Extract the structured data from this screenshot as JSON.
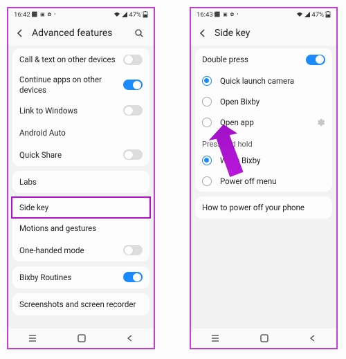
{
  "status": {
    "time1": "16:42",
    "time2": "16:43",
    "icons": "⬛ ▣ ✿ •",
    "battery": "47%"
  },
  "screen1": {
    "title": "Advanced features",
    "items": {
      "call_text": "Call & text on other devices",
      "continue_apps": "Continue apps on other devices",
      "link_windows": "Link to Windows",
      "android_auto": "Android Auto",
      "quick_share": "Quick Share",
      "labs": "Labs",
      "side_key": "Side key",
      "motions": "Motions and gestures",
      "one_handed": "One-handed mode",
      "bixby_routines": "Bixby Routines",
      "screenshots": "Screenshots and screen recorder"
    }
  },
  "screen2": {
    "title": "Side key",
    "double_press": "Double press",
    "opts1": {
      "camera": "Quick launch camera",
      "bixby": "Open Bixby",
      "app": "Open app"
    },
    "press_hold": "Press and hold",
    "opts2": {
      "wake": "Wake Bixby",
      "poweroff": "Power off menu"
    },
    "howto": "How to power off your phone"
  }
}
